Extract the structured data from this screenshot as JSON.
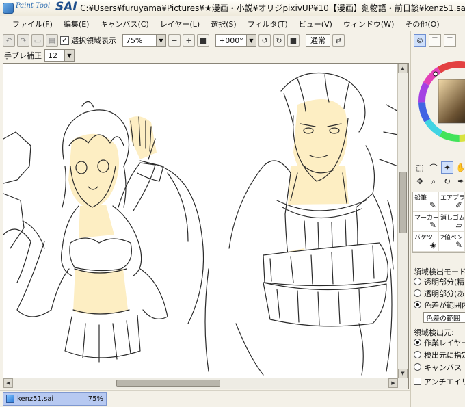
{
  "window": {
    "logo_small": "Paint Tool",
    "logo_big": "SAI",
    "path": "C:¥Users¥furuyama¥Pictures¥★漫画・小説¥オリジpixivUP¥10【漫画】剣物語・前日談¥kenz51.sai"
  },
  "menu": [
    "ファイル(F)",
    "編集(E)",
    "キャンバス(C)",
    "レイヤー(L)",
    "選択(S)",
    "フィルタ(T)",
    "ビュー(V)",
    "ウィンドウ(W)",
    "その他(O)"
  ],
  "toolbar": {
    "show_selection_label": "選択領域表示",
    "show_selection_checked": true,
    "zoom_value": "75%",
    "rotation_value": "+000°",
    "blend_button": "通常"
  },
  "stabilizer": {
    "label": "手ブレ補正",
    "value": "12"
  },
  "canvas": {
    "vscroll_position": 0.42,
    "hscroll_position": 0.38
  },
  "document_tab": {
    "name": "kenz51.sai",
    "zoom": "75%"
  },
  "right_panel": {
    "brushes": [
      {
        "label": "鉛筆",
        "icon": "pencil-icon"
      },
      {
        "label": "エアブラシ",
        "icon": "airbrush-icon"
      },
      {
        "label": "マーカー",
        "icon": "marker-icon"
      },
      {
        "label": "消しゴム",
        "icon": "eraser-icon"
      },
      {
        "label": "バケツ",
        "icon": "bucket-icon"
      },
      {
        "label": "2値ペン",
        "icon": "binary-pen-icon"
      }
    ],
    "detect_mode_label": "領域検出モード:",
    "detect_mode_options": [
      {
        "label": "透明部分(精",
        "selected": false
      },
      {
        "label": "透明部分(あ",
        "selected": false
      },
      {
        "label": "色差が範囲内",
        "selected": true
      }
    ],
    "color_range_select": "色差の範囲",
    "detect_source_label": "領域検出元:",
    "detect_source_options": [
      {
        "label": "作業レイヤー",
        "selected": true
      },
      {
        "label": "検出元に指定",
        "selected": false
      },
      {
        "label": "キャンバス",
        "selected": false
      }
    ],
    "antialias_label": "アンチエイリアス",
    "antialias_checked": false
  },
  "colors": {
    "titlebar": "#efeadb",
    "panel_bg": "#f4f1e8",
    "skin": "#fdeec3",
    "ink": "#2a2a2a",
    "tab_active": "#b7c9f1"
  }
}
